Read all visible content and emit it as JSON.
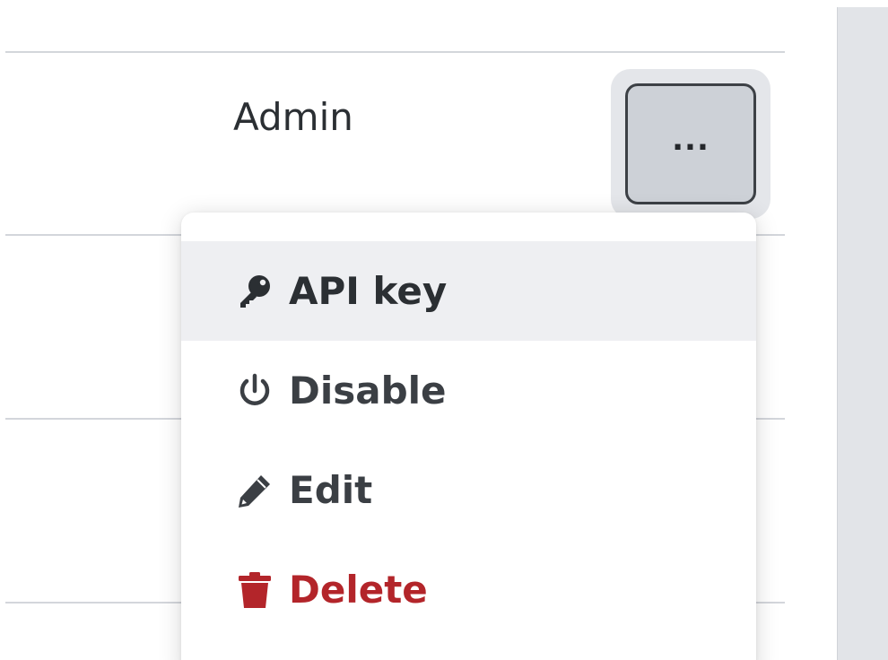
{
  "row": {
    "role": "Admin"
  },
  "actions_button": {
    "label": "..."
  },
  "menu": {
    "items": [
      {
        "label": "API key",
        "icon": "key-icon"
      },
      {
        "label": "Disable",
        "icon": "power-icon"
      },
      {
        "label": "Edit",
        "icon": "pencil-icon"
      },
      {
        "label": "Delete",
        "icon": "trash-icon",
        "color": "#b3252a"
      }
    ]
  }
}
